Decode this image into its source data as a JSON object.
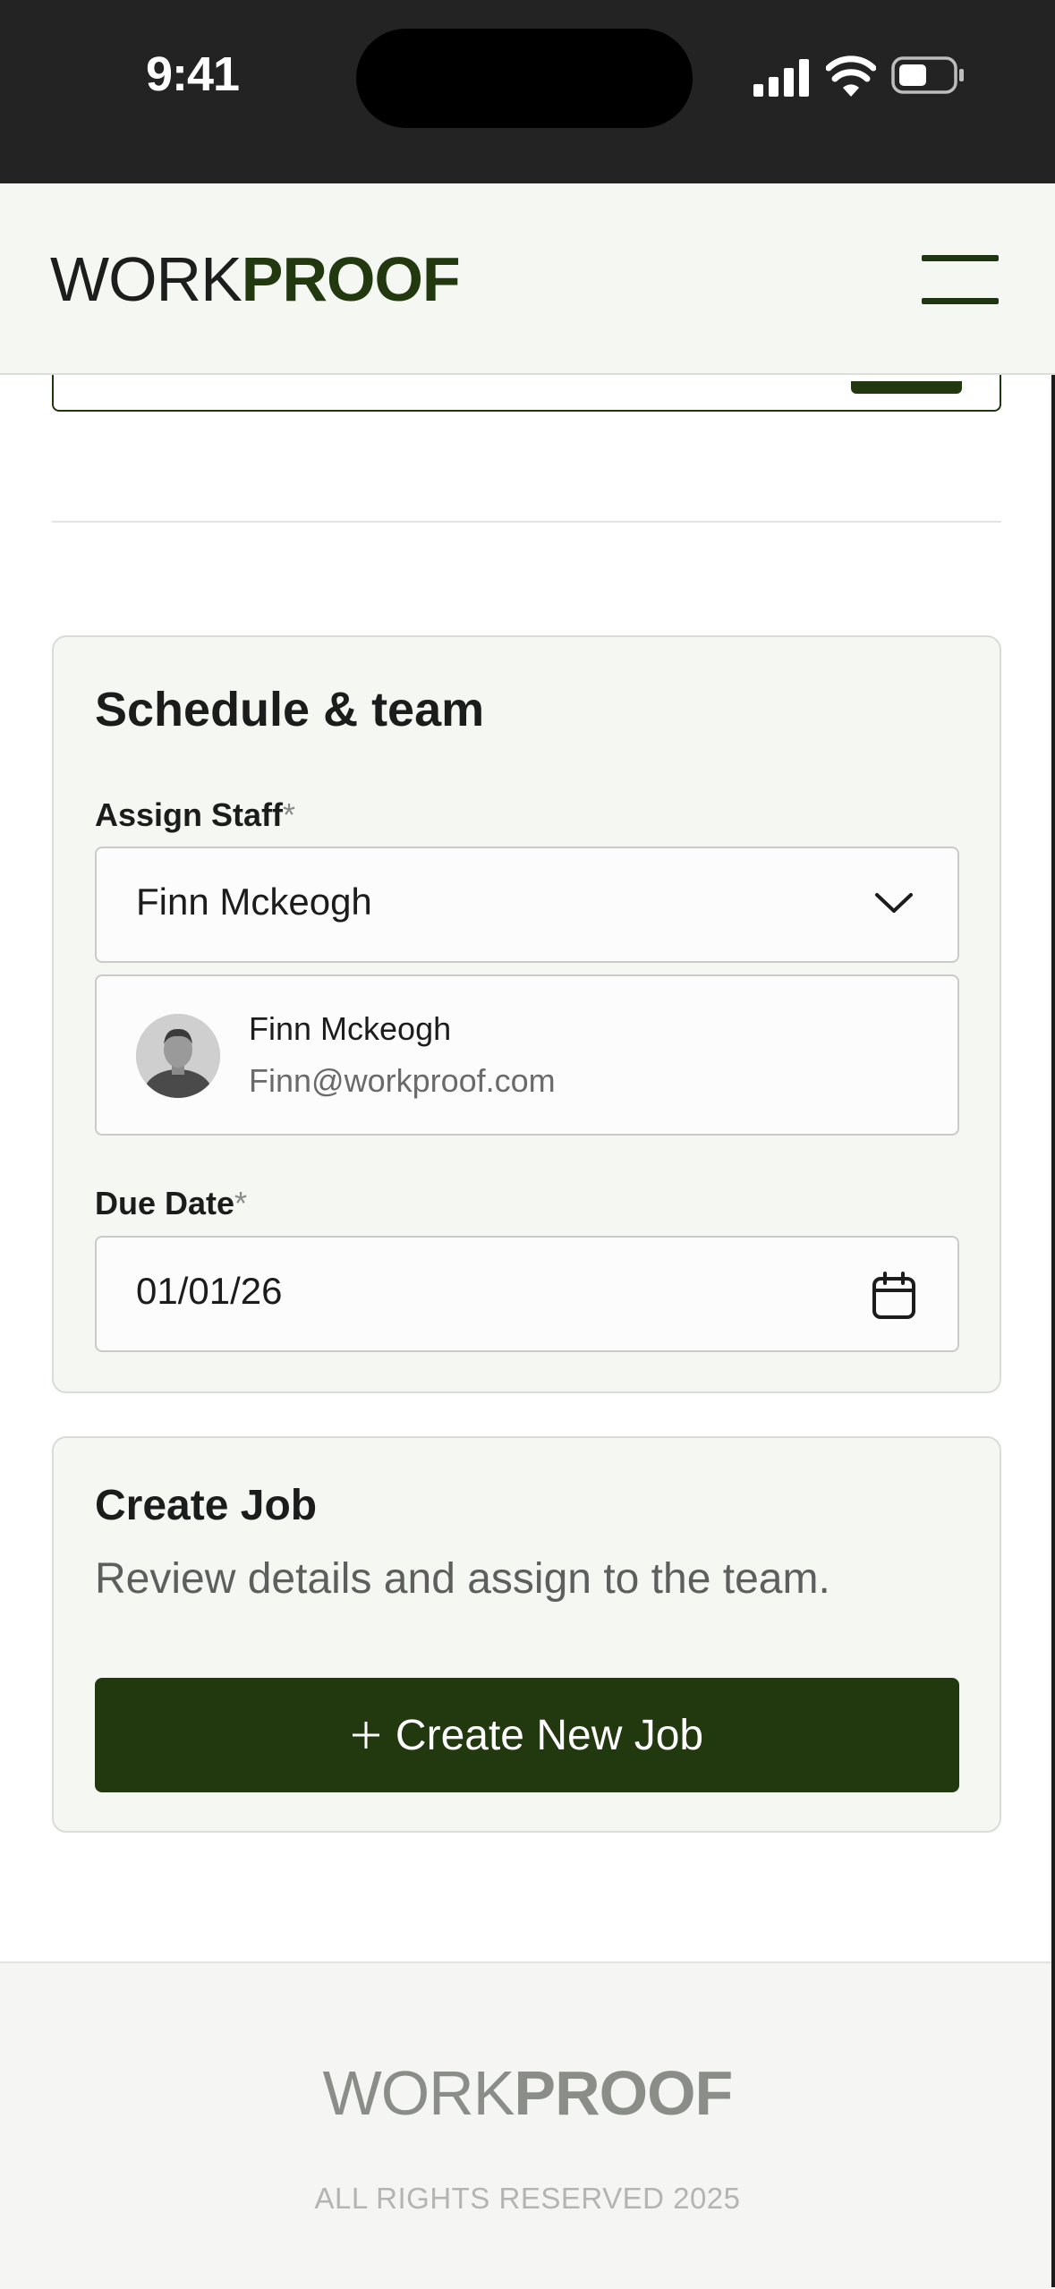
{
  "status_bar": {
    "time": "9:41",
    "icons": [
      "signal-icon",
      "wifi-icon",
      "battery-icon"
    ]
  },
  "header": {
    "logo_light": "WORK",
    "logo_bold": "PROOF",
    "menu_icon": "hamburger-menu-icon"
  },
  "schedule": {
    "title": "Schedule & team",
    "assign_staff": {
      "label": "Assign Staff",
      "required_mark": "*",
      "selected": "Finn Mckeogh",
      "icon": "chevron-down-icon"
    },
    "staff_card": {
      "name": "Finn Mckeogh",
      "email": "Finn@workproof.com"
    },
    "due_date": {
      "label": "Due Date",
      "required_mark": "*",
      "value": "01/01/26",
      "icon": "calendar-icon"
    }
  },
  "create_job": {
    "title": "Create Job",
    "subtitle": "Review details and assign to the team.",
    "button_label": "Create New Job",
    "button_icon": "plus-icon"
  },
  "footer": {
    "logo_light": "WORK",
    "logo_bold": "PROOF",
    "copyright": "ALL RIGHTS RESERVED 2025"
  },
  "colors": {
    "brand_green": "#22390f",
    "surface": "#f5f7f3",
    "status_bar": "#232323"
  }
}
